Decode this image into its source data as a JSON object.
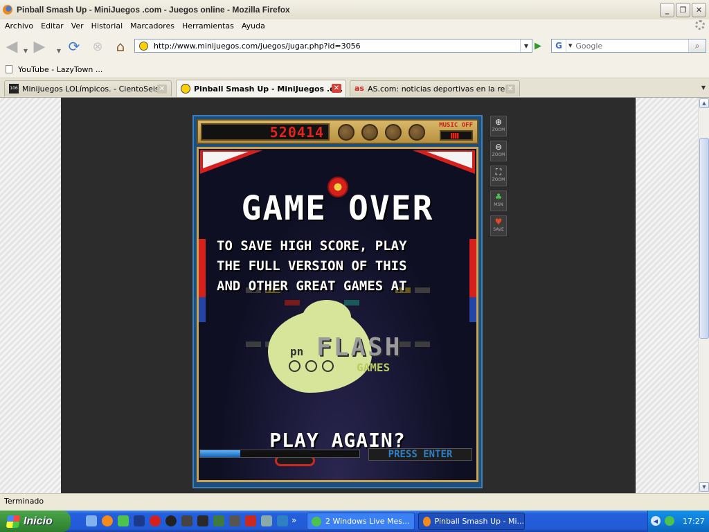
{
  "window": {
    "title": "Pinball Smash Up - MiniJuegos .com - Juegos online - Mozilla Firefox",
    "minimize": "_",
    "maximize": "❐",
    "close": "✕"
  },
  "menu": [
    "Archivo",
    "Editar",
    "Ver",
    "Historial",
    "Marcadores",
    "Herramientas",
    "Ayuda"
  ],
  "nav": {
    "url": "http://www.minijuegos.com/juegos/jugar.php?id=3056",
    "search_placeholder": "Google",
    "search_engine_letter": "G"
  },
  "bookmarks": [
    {
      "label": "YouTube - LazyTown ..."
    }
  ],
  "tabs": [
    {
      "label": "Minijuegos LOLímpicos. - CientoSeis",
      "active": false
    },
    {
      "label": "Pinball Smash Up - MiniJuegos .c...",
      "active": true
    },
    {
      "label": "AS.com: noticias deportivas en la red",
      "active": false
    }
  ],
  "tab_icon_text": {
    "ciento": "106",
    "as": "as"
  },
  "game": {
    "score": "520414",
    "music_label": "MUSIC OFF",
    "game_over": "GAME OVER",
    "save_message": "TO SAVE HIGH SCORE, PLAY\nTHE FULL VERSION OF THIS\nAND OTHER GREAT GAMES AT",
    "logo_pn": "pn",
    "logo_flash": "FLASH",
    "logo_games": "GAMES",
    "play_again": "PLAY AGAIN?",
    "press_enter": "PRESS ENTER",
    "progress_fraction": 0.25,
    "balls_remaining_slots": 4
  },
  "zoom_tools": [
    {
      "icon": "zoom-in-icon",
      "label": "ZOOM"
    },
    {
      "icon": "zoom-out-icon",
      "label": "ZOOM"
    },
    {
      "icon": "zoom-fit-icon",
      "label": "ZOOM"
    },
    {
      "icon": "msn-icon",
      "label": "MSN"
    },
    {
      "icon": "save-icon",
      "label": "SAVE"
    }
  ],
  "status": "Terminado",
  "taskbar": {
    "start_label": "Inicio",
    "buttons": [
      {
        "label": "2 Windows Live Mes...",
        "active": false
      },
      {
        "label": "Pinball Smash Up - Mi...",
        "active": true
      }
    ],
    "clock": "17:27"
  },
  "colors": {
    "score_red": "#e0261c",
    "press_enter_blue": "#2e7fc4",
    "logo_green": "#d7e59a"
  }
}
